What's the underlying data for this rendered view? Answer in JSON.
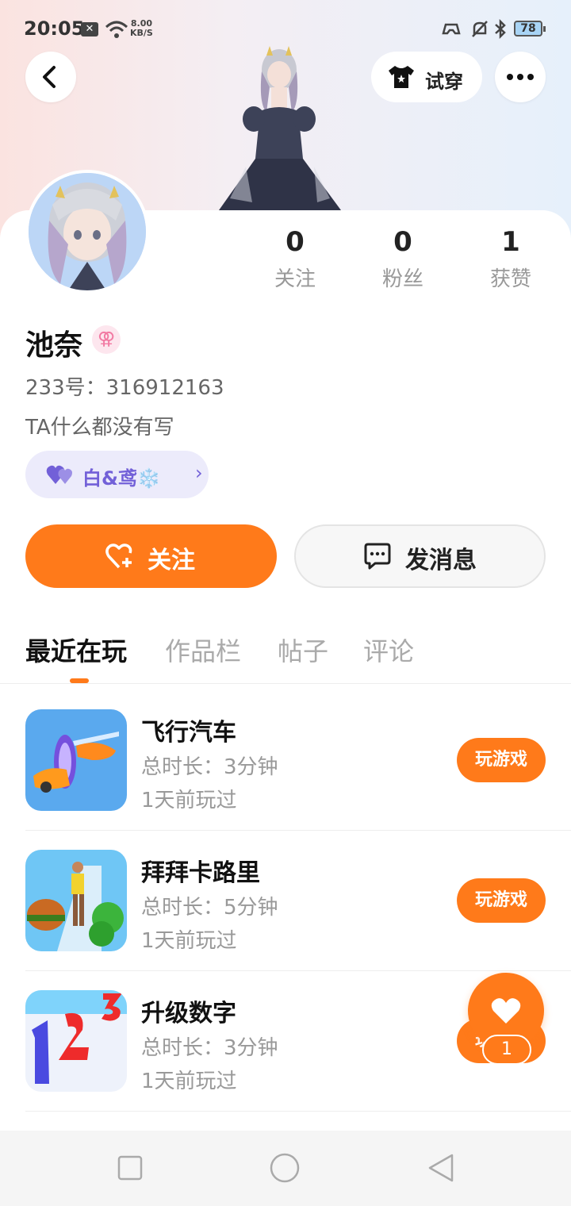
{
  "status_bar": {
    "time": "20:05",
    "sim_label": "✕",
    "speed_value": "8.00",
    "speed_unit": "KB/S",
    "battery": "78"
  },
  "header": {
    "tryon_label": "试穿"
  },
  "stats": [
    {
      "value": "0",
      "label": "关注"
    },
    {
      "value": "0",
      "label": "粉丝"
    },
    {
      "value": "1",
      "label": "获赞"
    }
  ],
  "profile": {
    "name": "池奈",
    "gender_symbol": "⚢",
    "uid": "233号：316912163",
    "bio": "TA什么都没有写",
    "tag_label": "白&鸢❄️"
  },
  "actions": {
    "follow_label": "关注",
    "message_label": "发消息"
  },
  "tabs": [
    "最近在玩",
    "作品栏",
    "帖子",
    "评论"
  ],
  "games": [
    {
      "title": "飞行汽车",
      "duration": "总时长：3分钟",
      "last_played": "1天前玩过",
      "play_label": "玩游戏"
    },
    {
      "title": "拜拜卡路里",
      "duration": "总时长：5分钟",
      "last_played": "1天前玩过",
      "play_label": "玩游戏"
    },
    {
      "title": "升级数字",
      "duration": "总时长：3分钟",
      "last_played": "1天前玩过",
      "play_label": "玩游戏"
    }
  ],
  "float_like": {
    "count": "1"
  },
  "colors": {
    "accent": "#ff7a1a",
    "tag_bg": "#ecebfb",
    "tag_text": "#7260d8"
  }
}
